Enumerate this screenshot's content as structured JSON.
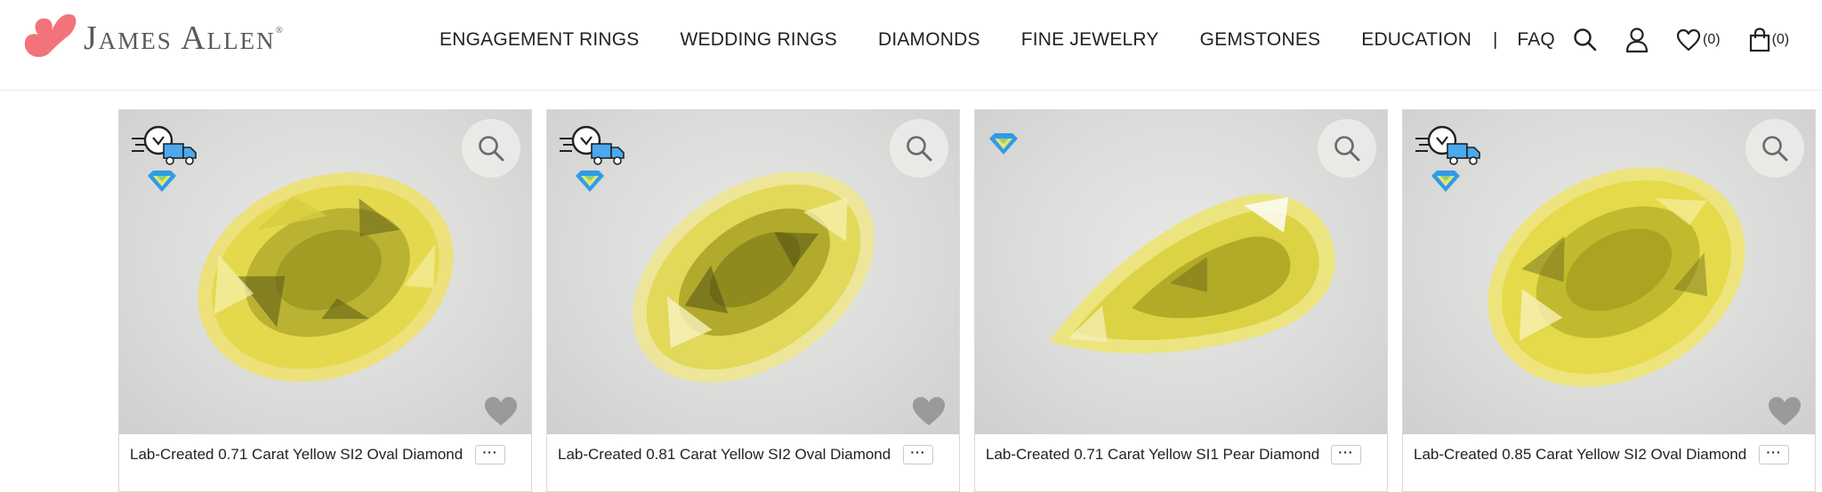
{
  "header": {
    "logo_text": "James Allen",
    "logo_reg": "®",
    "nav": [
      {
        "label": "ENGAGEMENT RINGS"
      },
      {
        "label": "WEDDING RINGS"
      },
      {
        "label": "DIAMONDS"
      },
      {
        "label": "FINE JEWELRY"
      },
      {
        "label": "GEMSTONES"
      },
      {
        "label": "EDUCATION"
      },
      {
        "label": "FAQ"
      }
    ],
    "nav_separator": "|",
    "wishlist_count": "(0)",
    "cart_count": "(0)",
    "icons": [
      "search-icon",
      "user-icon",
      "heart-icon",
      "shopping-bag-icon"
    ]
  },
  "products": [
    {
      "title": "Lab-Created 0.71 Carat Yellow SI2 Oval Diamond",
      "more": "···",
      "shape": "Oval",
      "fast_shipping": true,
      "lab_created_badge": true
    },
    {
      "title": "Lab-Created 0.81 Carat Yellow SI2 Oval Diamond",
      "more": "···",
      "shape": "Oval",
      "fast_shipping": true,
      "lab_created_badge": true
    },
    {
      "title": "Lab-Created 0.71 Carat Yellow SI1 Pear Diamond",
      "more": "···",
      "shape": "Pear",
      "fast_shipping": false,
      "lab_created_badge": true
    },
    {
      "title": "Lab-Created 0.85 Carat Yellow SI2 Oval Diamond",
      "more": "···",
      "shape": "Oval",
      "fast_shipping": true,
      "lab_created_badge": true
    }
  ],
  "colors": {
    "logo_pink": "#f2737a",
    "diamond_yellow": "#e4d94c",
    "diamond_dark": "#8c8a1e",
    "badge_blue": "#2f9be8"
  }
}
